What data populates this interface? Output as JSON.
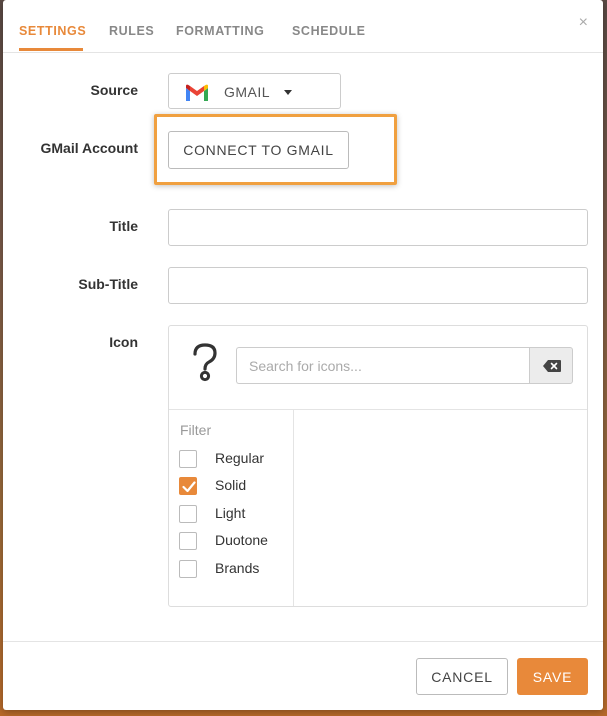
{
  "tabs": [
    {
      "label": "SETTINGS",
      "active": true
    },
    {
      "label": "RULES",
      "active": false
    },
    {
      "label": "FORMATTING",
      "active": false
    },
    {
      "label": "SCHEDULE",
      "active": false
    }
  ],
  "close_glyph": "×",
  "form": {
    "source_label": "Source",
    "source_value": "GMAIL",
    "account_label": "GMail Account",
    "connect_button": "CONNECT TO GMAIL",
    "title_label": "Title",
    "title_value": "",
    "subtitle_label": "Sub-Title",
    "subtitle_value": "",
    "icon_label": "Icon"
  },
  "icon_picker": {
    "search_placeholder": "Search for icons...",
    "filter_label": "Filter",
    "filters": [
      {
        "label": "Regular",
        "checked": false
      },
      {
        "label": "Solid",
        "checked": true
      },
      {
        "label": "Light",
        "checked": false
      },
      {
        "label": "Duotone",
        "checked": false
      },
      {
        "label": "Brands",
        "checked": false
      }
    ]
  },
  "footer": {
    "cancel": "CANCEL",
    "save": "SAVE"
  },
  "colors": {
    "accent": "#e8893a",
    "highlight_border": "#f0a040"
  }
}
